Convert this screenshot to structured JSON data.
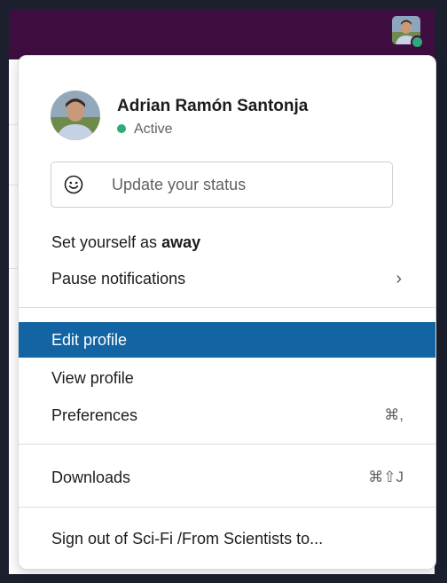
{
  "profile": {
    "name": "Adrian Ramón Santonja",
    "status": "Active"
  },
  "status_input": {
    "placeholder": "Update your status"
  },
  "menu": {
    "away_prefix": "Set yourself as ",
    "away_emphasis": "away",
    "pause_notifications": "Pause notifications",
    "pause_chevron": "›",
    "edit_profile": "Edit profile",
    "view_profile": "View profile",
    "preferences": "Preferences",
    "preferences_shortcut": "⌘,",
    "downloads": "Downloads",
    "downloads_shortcut": "⌘⇧J",
    "sign_out": "Sign out of Sci-Fi /From Scientists to..."
  },
  "colors": {
    "workspace_bar": "#3f0e40",
    "highlight": "#1264a3",
    "presence": "#2bac76"
  },
  "icons": {
    "status": "smiley-icon",
    "submenu": "chevron-right-icon"
  }
}
